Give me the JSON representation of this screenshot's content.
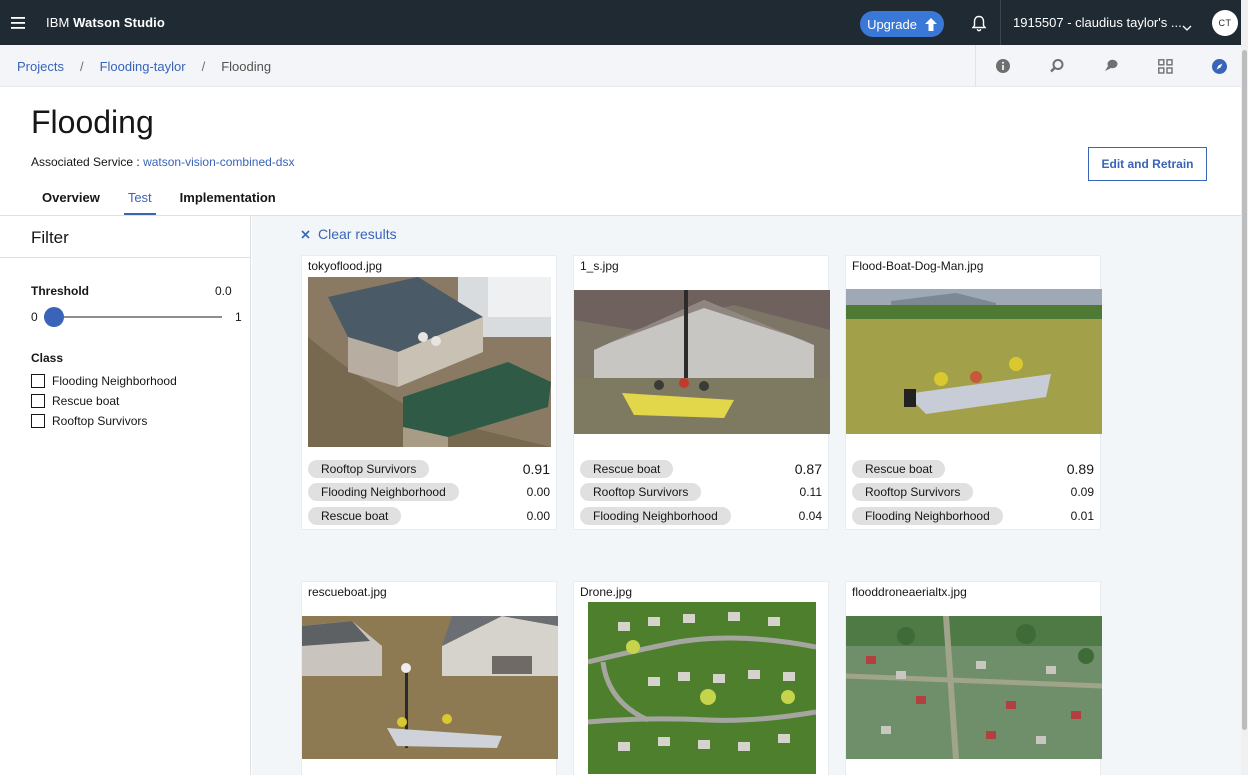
{
  "topbar": {
    "brand_prefix": "IBM ",
    "brand_name": "Watson Studio",
    "upgrade_label": "Upgrade",
    "account_label": "1915507 - claudius taylor's ...",
    "avatar_initials": "CT"
  },
  "breadcrumb": {
    "items": [
      "Projects",
      "Flooding-taylor"
    ],
    "current": "Flooding",
    "separator": "/"
  },
  "header": {
    "title": "Flooding",
    "associated_label": "Associated Service : ",
    "associated_link": "watson-vision-combined-dsx",
    "edit_button": "Edit and Retrain"
  },
  "tabs": [
    {
      "label": "Overview",
      "active": false
    },
    {
      "label": "Test",
      "active": true
    },
    {
      "label": "Implementation",
      "active": false
    }
  ],
  "filter": {
    "title": "Filter",
    "threshold_label": "Threshold",
    "threshold_value": "0.0",
    "threshold_fraction": 0.0,
    "slider_min": "0",
    "slider_max": "1",
    "class_label": "Class",
    "classes": [
      "Flooding Neighborhood",
      "Rescue boat",
      "Rooftop Survivors"
    ]
  },
  "results": {
    "clear_label": "Clear results",
    "cards": [
      {
        "name": "tokyoflood.jpg",
        "image": "house-roof-flood",
        "results": [
          {
            "label": "Rooftop Survivors",
            "score": "0.91"
          },
          {
            "label": "Flooding Neighborhood",
            "score": "0.00"
          },
          {
            "label": "Rescue boat",
            "score": "0.00"
          }
        ]
      },
      {
        "name": "1_s.jpg",
        "image": "house-boat-flood",
        "results": [
          {
            "label": "Rescue boat",
            "score": "0.87"
          },
          {
            "label": "Rooftop Survivors",
            "score": "0.11"
          },
          {
            "label": "Flooding Neighborhood",
            "score": "0.04"
          }
        ]
      },
      {
        "name": "Flood-Boat-Dog-Man.jpg",
        "image": "boat-green-water",
        "results": [
          {
            "label": "Rescue boat",
            "score": "0.89"
          },
          {
            "label": "Rooftop Survivors",
            "score": "0.09"
          },
          {
            "label": "Flooding Neighborhood",
            "score": "0.01"
          }
        ]
      },
      {
        "name": "rescueboat.jpg",
        "image": "boat-houses-flood",
        "results": []
      },
      {
        "name": "Drone.jpg",
        "image": "aerial-suburb",
        "results": []
      },
      {
        "name": "flooddroneaerialtx.jpg",
        "image": "aerial-flood-town",
        "results": []
      }
    ]
  },
  "colors": {
    "topbar": "#1f2a33",
    "accent": "#3a64b8",
    "upgrade": "#3a78d8"
  }
}
